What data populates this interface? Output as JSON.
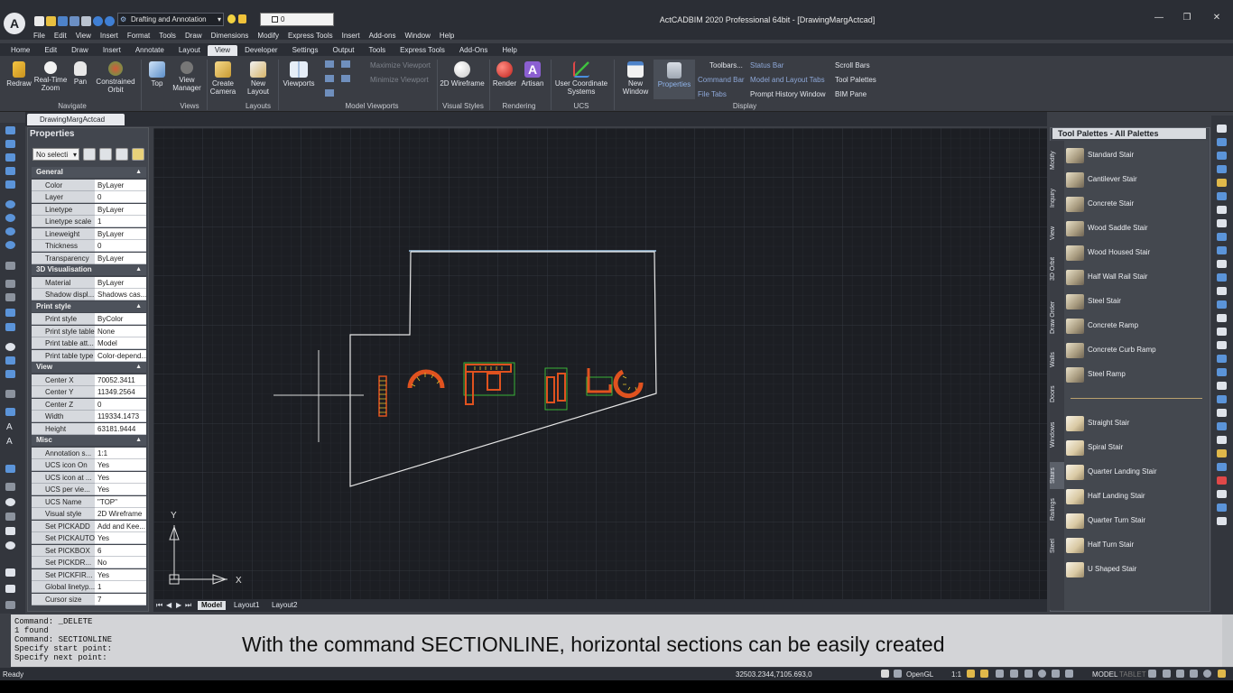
{
  "app": {
    "title": "ActCADBIM 2020 Professional 64bit - [DrawingMargActcad]",
    "logo_letter": "A",
    "workspace": "Drafting and Annotation",
    "layer_value": "0"
  },
  "menu": [
    "File",
    "Edit",
    "View",
    "Insert",
    "Format",
    "Tools",
    "Draw",
    "Dimensions",
    "Modify",
    "Express Tools",
    "Insert",
    "Add-ons",
    "Window",
    "Help"
  ],
  "ribbon_tabs": [
    "Home",
    "Edit",
    "Draw",
    "Insert",
    "Annotate",
    "Layout",
    "View",
    "Developer",
    "Settings",
    "Output",
    "Tools",
    "Express Tools",
    "Add-Ons",
    "Help"
  ],
  "ribbon_active_tab": "View",
  "ribbon": {
    "navigate": {
      "label": "Navigate",
      "buttons": [
        "Redraw",
        "Real-Time Zoom",
        "Pan",
        "Constrained Orbit"
      ]
    },
    "views": {
      "label": "Views",
      "buttons": [
        "Top",
        "View Manager"
      ]
    },
    "layouts": {
      "label": "Layouts",
      "buttons": [
        "Create Camera",
        "New Layout"
      ]
    },
    "model_viewports": {
      "label": "Model Viewports",
      "buttons": [
        "Viewports"
      ],
      "maximize": "Maximize Viewport",
      "minimize": "Minimize Viewport"
    },
    "visual_styles": {
      "label": "Visual Styles",
      "buttons": [
        "2D Wireframe"
      ]
    },
    "rendering": {
      "label": "Rendering",
      "buttons": [
        "Render",
        "Artisan"
      ]
    },
    "ucs": {
      "label": "UCS",
      "buttons": [
        "User Coordinate Systems"
      ]
    },
    "display": {
      "label": "Display",
      "new_window": "New Window",
      "properties": "Properties",
      "col1": [
        "Toolbars...",
        "Command Bar",
        "File Tabs"
      ],
      "col2": [
        "Status Bar",
        "Model and Layout Tabs",
        "Prompt History Window"
      ],
      "col3": [
        "Scroll Bars",
        "Tool Palettes",
        "BIM Pane"
      ]
    }
  },
  "document_tab": "DrawingMargActcad",
  "properties": {
    "title": "Properties",
    "selection": "No selecti",
    "sections": [
      {
        "name": "General",
        "rows": [
          [
            "Color",
            "ByLayer"
          ],
          [
            "Layer",
            "0"
          ],
          [
            "Linetype",
            "ByLayer"
          ],
          [
            "Linetype scale",
            "1"
          ],
          [
            "Lineweight",
            "ByLayer"
          ],
          [
            "Thickness",
            "0"
          ],
          [
            "Transparency",
            "ByLayer"
          ]
        ]
      },
      {
        "name": "3D Visualisation",
        "rows": [
          [
            "Material",
            "ByLayer"
          ],
          [
            "Shadow displ...",
            "Shadows cas..."
          ]
        ]
      },
      {
        "name": "Print style",
        "rows": [
          [
            "Print style",
            "ByColor"
          ],
          [
            "Print style table",
            "None"
          ],
          [
            "Print table att...",
            "Model"
          ],
          [
            "Print table type",
            "Color-depend..."
          ]
        ]
      },
      {
        "name": "View",
        "rows": [
          [
            "Center X",
            "70052.3411"
          ],
          [
            "Center Y",
            "11349.2564"
          ],
          [
            "Center Z",
            "0"
          ],
          [
            "Width",
            "119334.1473"
          ],
          [
            "Height",
            "63181.9444"
          ]
        ]
      },
      {
        "name": "Misc",
        "rows": [
          [
            "Annotation s...",
            "1:1"
          ],
          [
            "UCS icon On",
            "Yes"
          ],
          [
            "UCS icon at ...",
            "Yes"
          ],
          [
            "UCS per vie...",
            "Yes"
          ],
          [
            "UCS Name",
            "\"TOP\""
          ],
          [
            "Visual style",
            "2D Wireframe"
          ],
          [
            "Set PICKADD",
            "Add and Kee..."
          ],
          [
            "Set PICKAUTO",
            "Yes"
          ],
          [
            "Set PICKBOX",
            "6"
          ],
          [
            "Set PICKDR...",
            "No"
          ],
          [
            "Set PICKFIR...",
            "Yes"
          ],
          [
            "Global linetyp...",
            "1"
          ],
          [
            "Cursor size",
            "7"
          ]
        ]
      }
    ]
  },
  "layout_tabs": [
    "Model",
    "Layout1",
    "Layout2"
  ],
  "ucs_labels": {
    "x": "X",
    "y": "Y"
  },
  "tool_palette": {
    "title": "Tool Palettes - All Palettes",
    "side_tabs": [
      "Modify",
      "Inquiry",
      "View",
      "3D Orbit",
      "Draw Order",
      "Walls",
      "Doors",
      "Windows",
      "Stairs",
      "Railings",
      "Steel"
    ],
    "active_side_tab": "Stairs",
    "group1": [
      "Standard Stair",
      "Cantilever Stair",
      "Concrete Stair",
      "Wood Saddle Stair",
      "Wood Housed Stair",
      "Half Wall Rail Stair",
      "Steel Stair",
      "Concrete Ramp",
      "Concrete Curb Ramp",
      "Steel Ramp"
    ],
    "group2": [
      "Straight Stair",
      "Spiral Stair",
      "Quarter Landing Stair",
      "Half Landing Stair",
      "Quarter Turn Stair",
      "Half Turn Stair",
      "U Shaped Stair"
    ]
  },
  "command_history": "Command: _DELETE\n1 found\nCommand: SECTIONLINE\nSpecify start point:\nSpecify next point:",
  "caption": "With the command SECTIONLINE, horizontal sections can be easily created",
  "status": {
    "ready": "Ready",
    "coords": "32503.2344,7105.693,0",
    "opengl": "OpenGL",
    "scale": "1:1",
    "model": "MODEL",
    "tablet": "TABLET"
  },
  "colors": {
    "accent": "#5d8fd6",
    "stair_red": "#e0521f",
    "stair_yellow": "#e8c52a",
    "outline": "#e6e6e6",
    "green_frame": "#3ec43a"
  }
}
